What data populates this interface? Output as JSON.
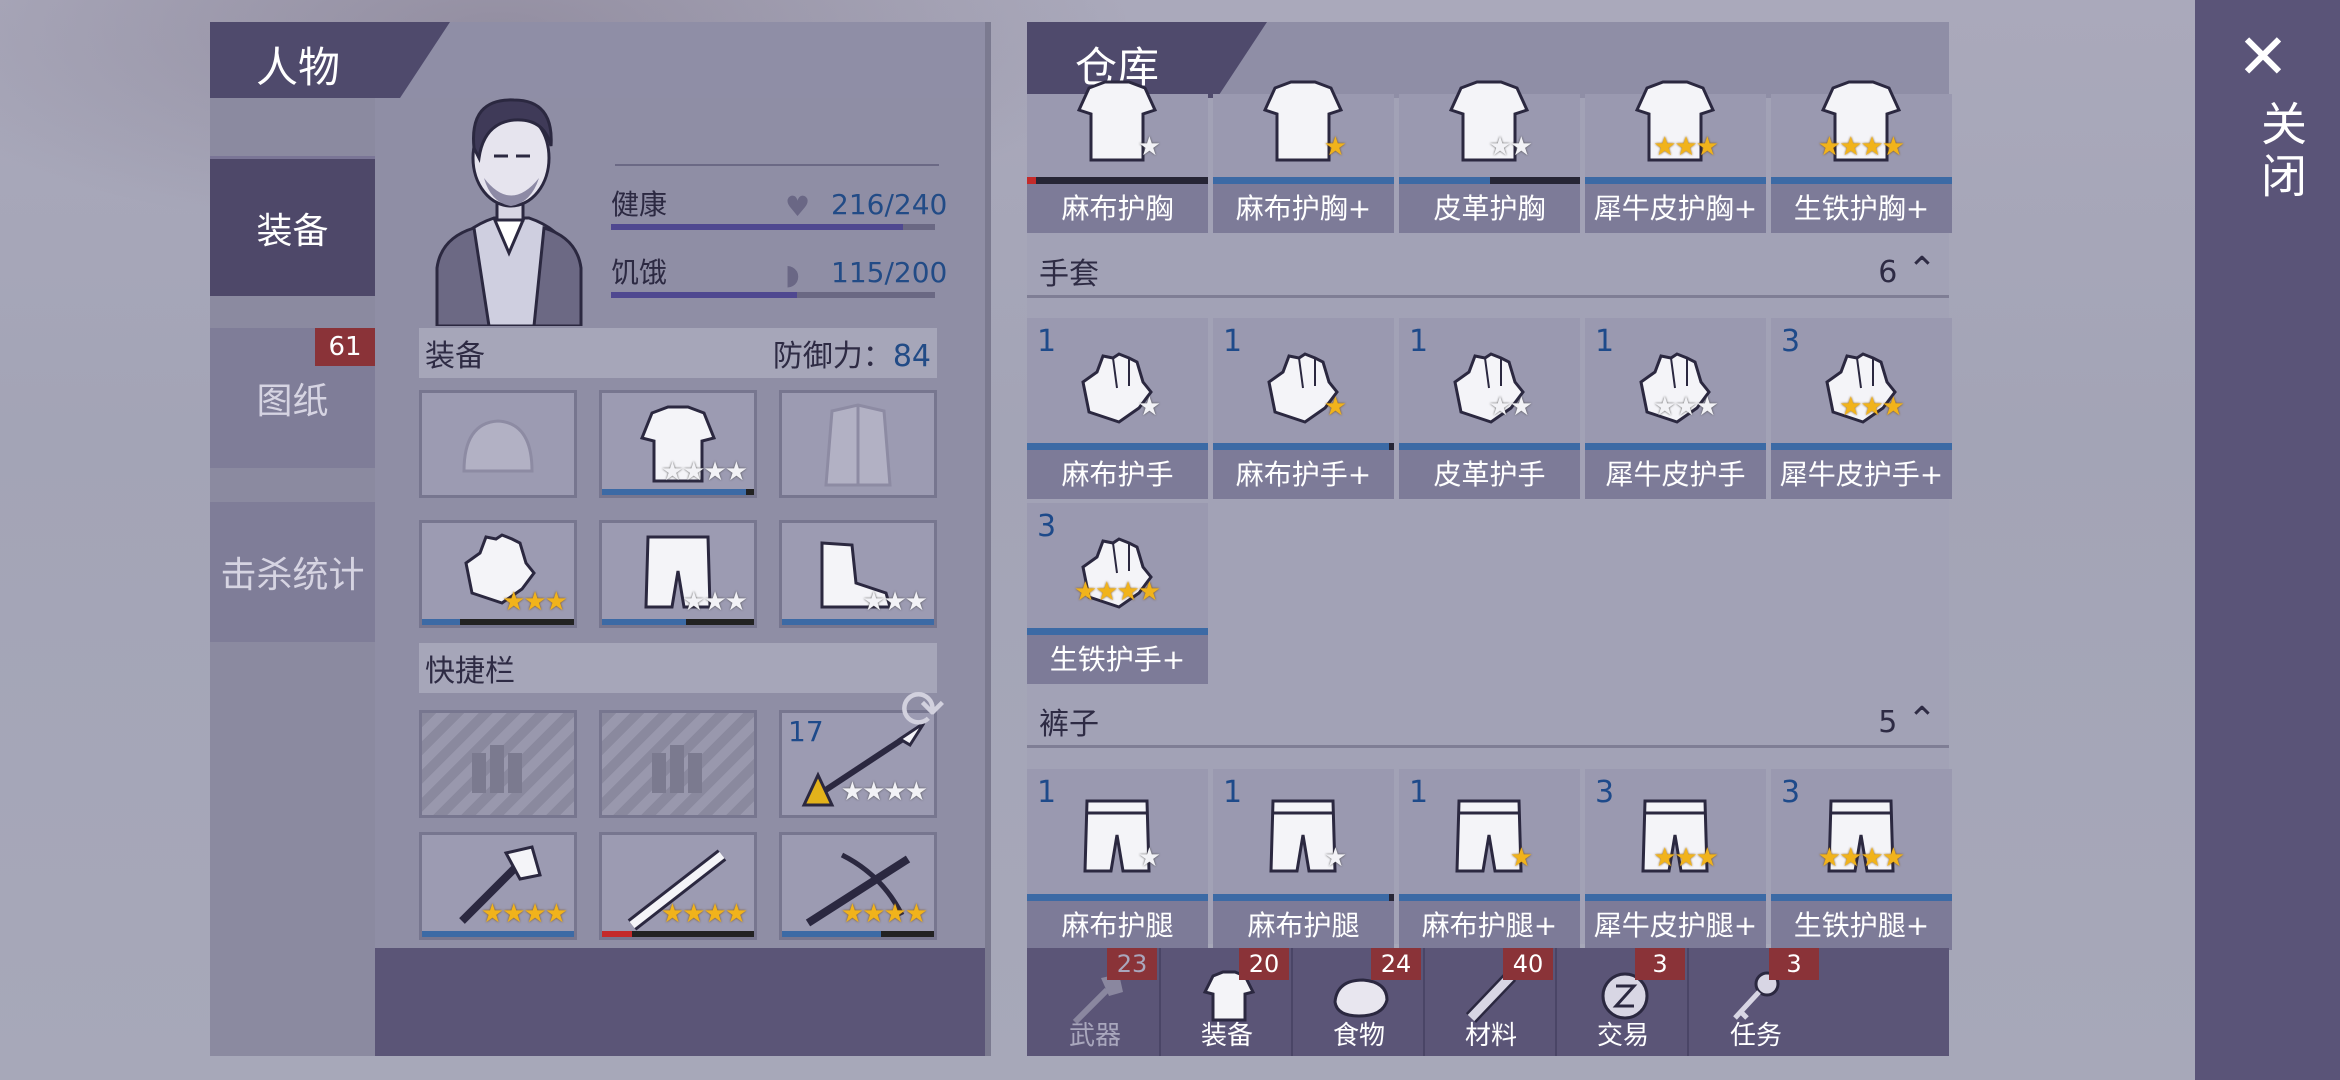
{
  "character": {
    "title": "人物",
    "tabs": [
      {
        "label": "装备",
        "active": true
      },
      {
        "label": "图纸",
        "badge": "61"
      },
      {
        "label": "击杀统计"
      }
    ],
    "health": {
      "label": "健康",
      "value": "216/240",
      "fraction": 0.9
    },
    "hunger": {
      "label": "饥饿",
      "value": "115/200",
      "fraction": 0.575
    },
    "equipment": {
      "label": "装备",
      "defense_label": "防御力：",
      "defense_value": "84"
    },
    "quickbar": {
      "label": "快捷栏",
      "spear_count": "17"
    }
  },
  "warehouse": {
    "title": "仓库",
    "chest_row": [
      {
        "name": "麻布护胸",
        "stars": 1,
        "gold": 0
      },
      {
        "name": "麻布护胸+",
        "stars": 1,
        "gold": 1
      },
      {
        "name": "皮革护胸",
        "stars": 2,
        "gold": 0
      },
      {
        "name": "犀牛皮护胸+",
        "stars": 3,
        "gold": 3
      },
      {
        "name": "生铁护胸+",
        "stars": 4,
        "gold": 4
      }
    ],
    "gloves": {
      "label": "手套",
      "count": "6",
      "items": [
        {
          "qty": "1",
          "name": "麻布护手",
          "stars": 1,
          "gold": 0
        },
        {
          "qty": "1",
          "name": "麻布护手+",
          "stars": 1,
          "gold": 1
        },
        {
          "qty": "1",
          "name": "皮革护手",
          "stars": 2,
          "gold": 0
        },
        {
          "qty": "1",
          "name": "犀牛皮护手",
          "stars": 3,
          "gold": 0
        },
        {
          "qty": "3",
          "name": "犀牛皮护手+",
          "stars": 3,
          "gold": 3
        },
        {
          "qty": "3",
          "name": "生铁护手+",
          "stars": 4,
          "gold": 4
        }
      ]
    },
    "pants": {
      "label": "裤子",
      "count": "5",
      "items": [
        {
          "qty": "1",
          "name": "麻布护腿",
          "stars": 1,
          "gold": 0
        },
        {
          "qty": "1",
          "name": "麻布护腿",
          "stars": 1,
          "gold": 0
        },
        {
          "qty": "1",
          "name": "麻布护腿+",
          "stars": 1,
          "gold": 1
        },
        {
          "qty": "3",
          "name": "犀牛皮护腿+",
          "stars": 3,
          "gold": 3
        },
        {
          "qty": "3",
          "name": "生铁护腿+",
          "stars": 4,
          "gold": 4
        }
      ]
    },
    "nav": [
      {
        "label": "武器",
        "badge": "23"
      },
      {
        "label": "装备",
        "badge": "20"
      },
      {
        "label": "食物",
        "badge": "24"
      },
      {
        "label": "材料",
        "badge": "40"
      },
      {
        "label": "交易",
        "badge": "3"
      },
      {
        "label": "任务",
        "badge": "3"
      }
    ]
  },
  "close": {
    "label": "关闭"
  },
  "colors": {
    "accent": "#4e4869",
    "badge": "#8a3338",
    "star_gold": "#f1b31b",
    "value_blue": "#224b86"
  }
}
